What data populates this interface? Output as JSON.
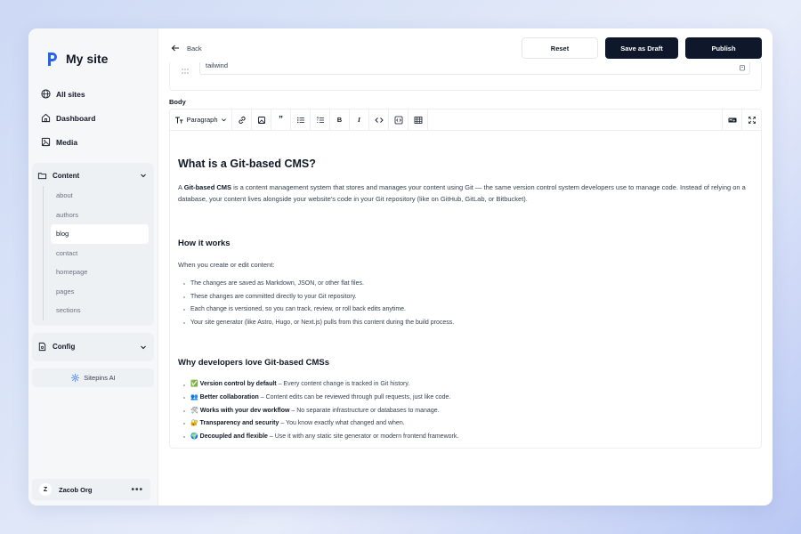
{
  "app": {
    "title": "My site"
  },
  "sidebar": {
    "nav": [
      {
        "label": "All sites",
        "icon": "globe-icon"
      },
      {
        "label": "Dashboard",
        "icon": "home-icon"
      },
      {
        "label": "Media",
        "icon": "image-icon"
      }
    ],
    "content_group": {
      "label": "Content",
      "items": [
        "about",
        "authors",
        "blog",
        "contact",
        "homepage",
        "pages",
        "sections"
      ],
      "active": "blog"
    },
    "config_label": "Config",
    "ai_label": "Sitepins AI",
    "org": {
      "initial": "Z",
      "name": "Zacob Org",
      "more": "•••"
    }
  },
  "topbar": {
    "back_label": "Back",
    "reset_label": "Reset",
    "draft_label": "Save as Draft",
    "publish_label": "Publish"
  },
  "tags": {
    "value": "tailwind"
  },
  "body_label": "Body",
  "toolbar": {
    "paragraph_label": "Paragraph",
    "bold": "B",
    "italic": "I",
    "quote": "”"
  },
  "document": {
    "h1": "What is a Git-based CMS?",
    "intro_bold": "Git-based CMS",
    "intro_pre": "A ",
    "intro_rest": " is a content management system that stores and manages your content using Git — the same version control system developers use to manage code. Instead of relying on a database, your content lives alongside your website's code in your Git repository (like on GitHub, GitLab, or Bitbucket).",
    "h2_a": "How it works",
    "how_intro": "When you create or edit content:",
    "how_items": [
      "The changes are saved as Markdown, JSON, or other flat files.",
      "These changes are committed directly to your Git repository.",
      "Each change is versioned, so you can track, review, or roll back edits anytime.",
      "Your site generator (like Astro, Hugo, or Next.js) pulls from this content during the build process."
    ],
    "h2_b": "Why developers love Git-based CMSs",
    "why_items": [
      {
        "emoji": "✅",
        "bold": "Version control by default",
        "rest": " – Every content change is tracked in Git history."
      },
      {
        "emoji": "👥",
        "bold": "Better collaboration",
        "rest": " – Content edits can be reviewed through pull requests, just like code."
      },
      {
        "emoji": "🛠",
        "bold": "Works with your dev workflow",
        "rest": " – No separate infrastructure or databases to manage."
      },
      {
        "emoji": "🔐",
        "bold": "Transparency and security",
        "rest": " – You know exactly what changed and when."
      },
      {
        "emoji": "🌍",
        "bold": "Decoupled and flexible",
        "rest": " – Use it with any static site generator or modern frontend framework."
      }
    ]
  },
  "colors": {
    "primary_button": "#0f172a",
    "sidebar_bg": "#f6f7f9"
  }
}
